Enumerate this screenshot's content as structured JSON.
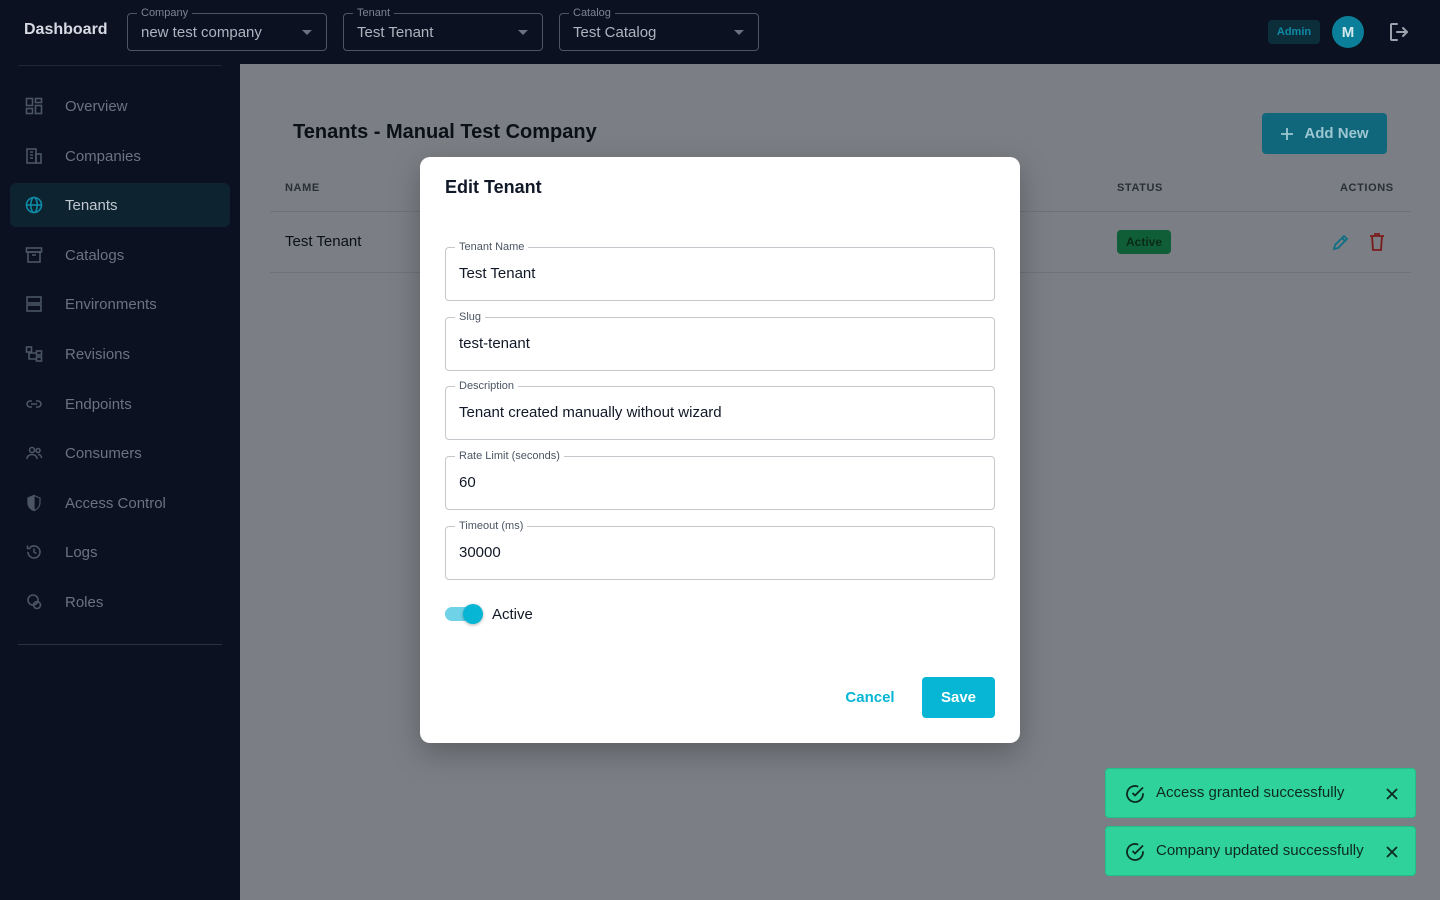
{
  "topbar": {
    "brand": "Dashboard",
    "company": {
      "label": "Company",
      "value": "new test company"
    },
    "tenant": {
      "label": "Tenant",
      "value": "Test Tenant"
    },
    "catalog": {
      "label": "Catalog",
      "value": "Test Catalog"
    },
    "admin_badge": "Admin",
    "avatar_initial": "M"
  },
  "sidebar": {
    "items": [
      {
        "label": "Overview",
        "icon": "dashboard-icon"
      },
      {
        "label": "Companies",
        "icon": "building-icon"
      },
      {
        "label": "Tenants",
        "icon": "globe-icon",
        "active": true
      },
      {
        "label": "Catalogs",
        "icon": "archive-icon"
      },
      {
        "label": "Environments",
        "icon": "server-icon"
      },
      {
        "label": "Revisions",
        "icon": "tree-icon"
      },
      {
        "label": "Endpoints",
        "icon": "link-icon"
      },
      {
        "label": "Consumers",
        "icon": "users-icon"
      },
      {
        "label": "Access Control",
        "icon": "shield-icon"
      },
      {
        "label": "Logs",
        "icon": "history-icon"
      },
      {
        "label": "Roles",
        "icon": "roles-icon"
      }
    ]
  },
  "main": {
    "title": "Tenants - Manual Test Company",
    "add_label": "Add New",
    "columns": {
      "name": "NAME",
      "status": "STATUS",
      "actions": "ACTIONS"
    },
    "rows": [
      {
        "name": "Test Tenant",
        "status": "Active"
      }
    ]
  },
  "modal": {
    "title": "Edit Tenant",
    "fields": [
      {
        "label": "Tenant Name",
        "value": "Test Tenant"
      },
      {
        "label": "Slug",
        "value": "test-tenant"
      },
      {
        "label": "Description",
        "value": "Tenant created manually without wizard"
      },
      {
        "label": "Rate Limit (seconds)",
        "value": "60"
      },
      {
        "label": "Timeout (ms)",
        "value": "30000"
      }
    ],
    "active_label": "Active",
    "active_on": true,
    "cancel_label": "Cancel",
    "save_label": "Save"
  },
  "toasts": [
    {
      "message": "Access granted successfully"
    },
    {
      "message": "Company updated successfully"
    }
  ],
  "colors": {
    "accent": "#06b6d4",
    "success": "#2fd29b",
    "sidebar_bg": "#0b1121",
    "danger": "#dc2626"
  }
}
